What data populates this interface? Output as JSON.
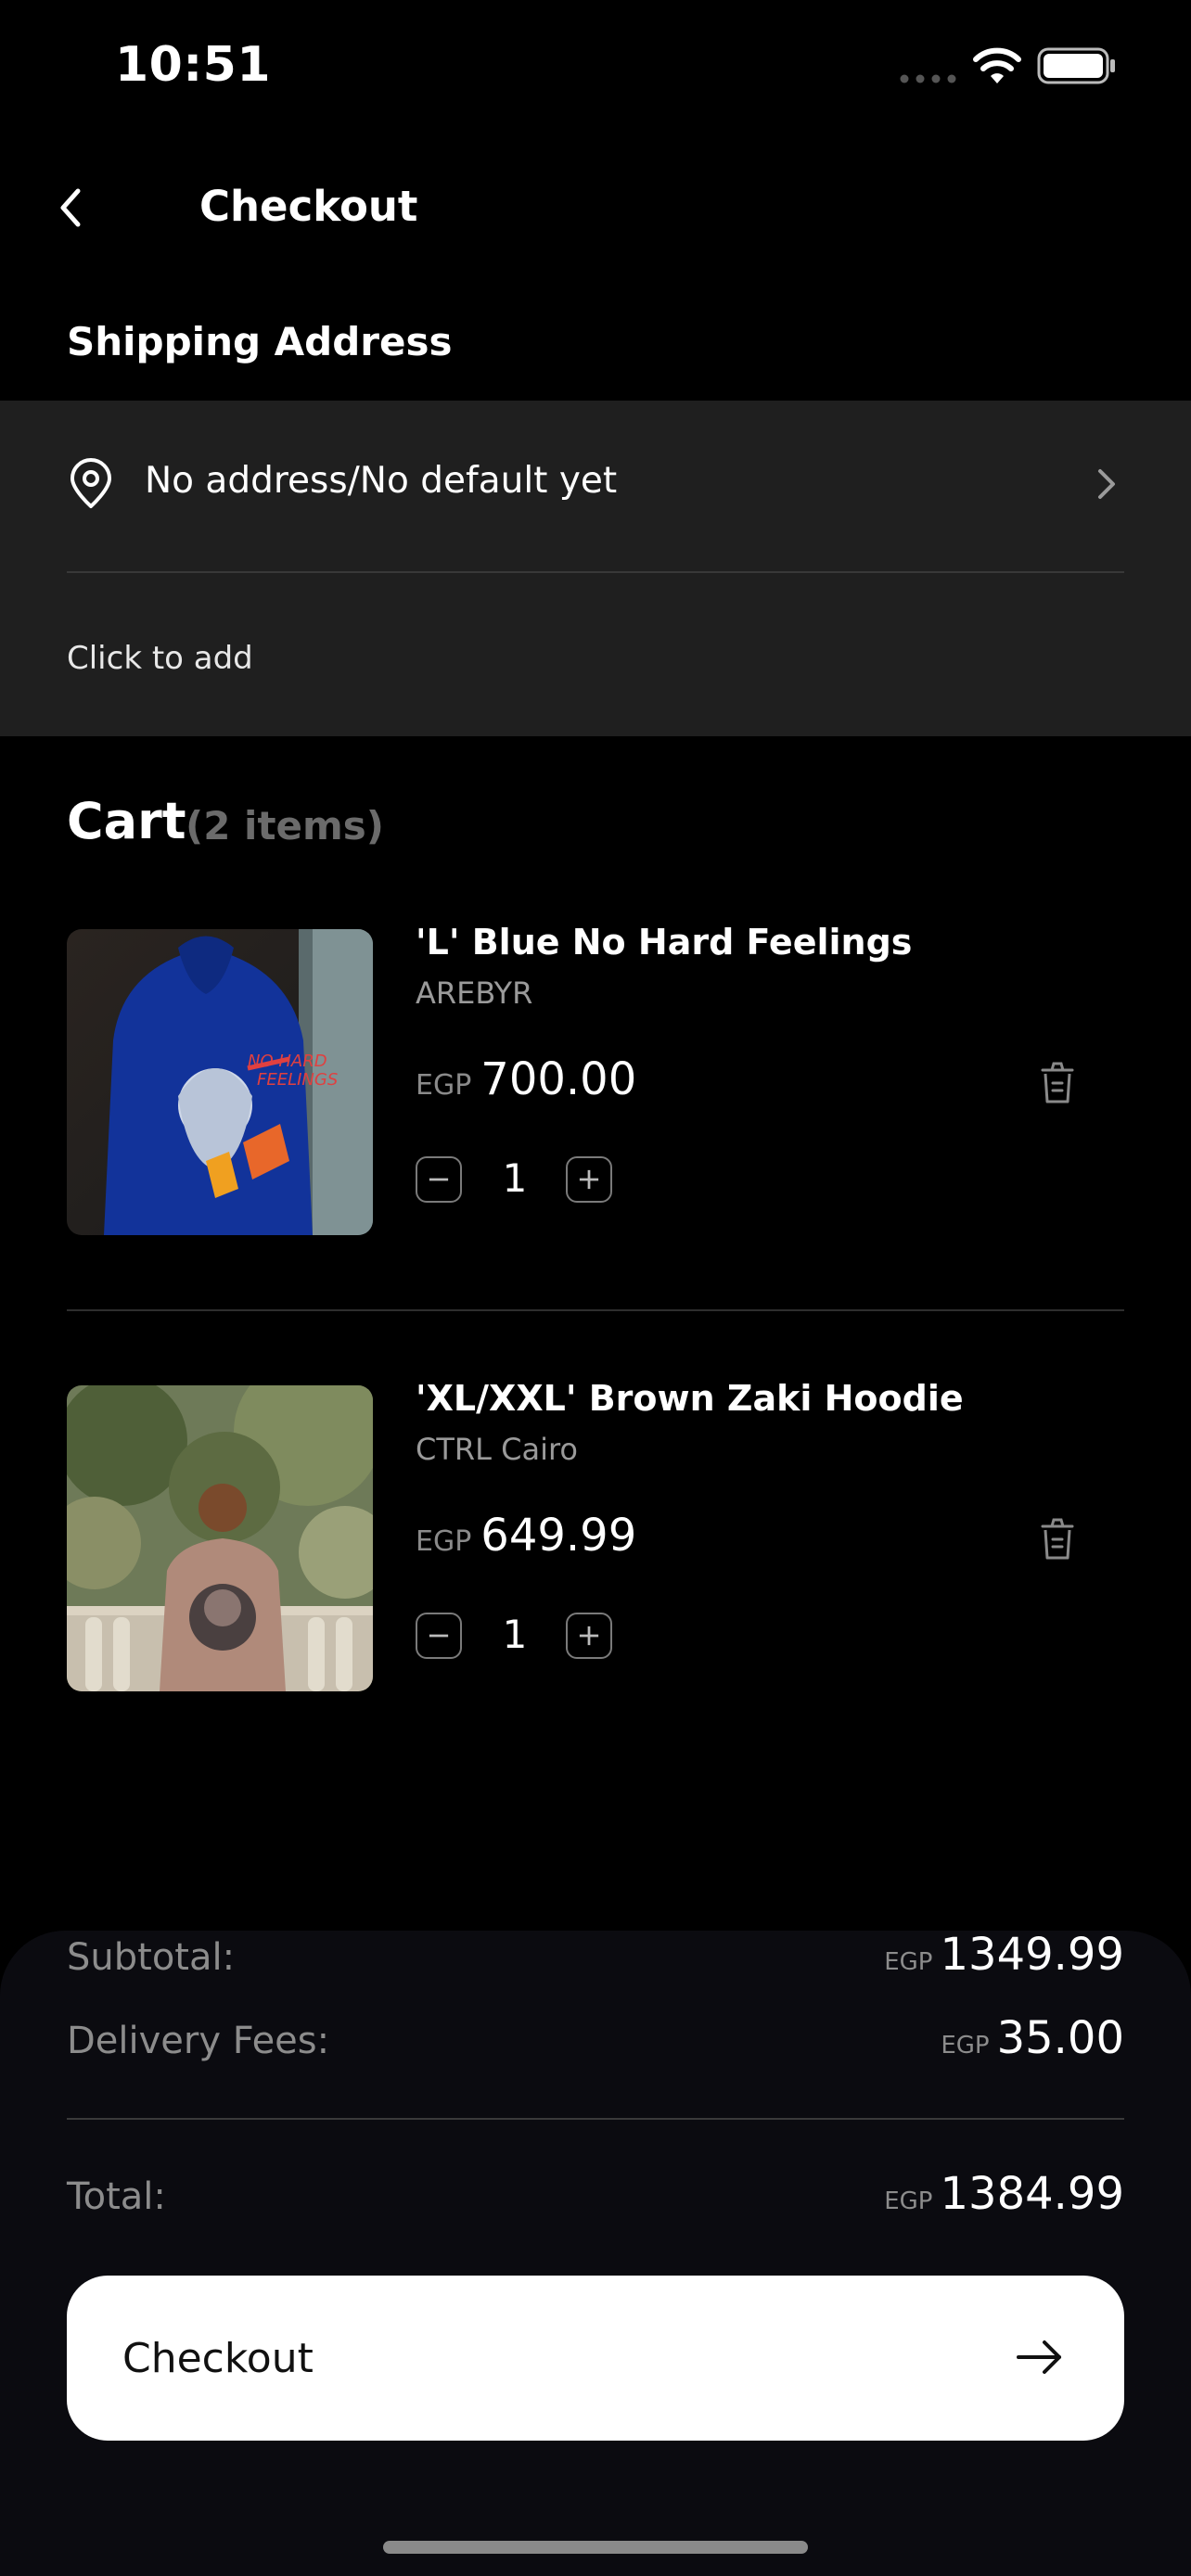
{
  "status_bar": {
    "time": "10:51"
  },
  "header": {
    "title": "Checkout"
  },
  "shipping": {
    "section_title": "Shipping Address",
    "address_text": "No address/No default yet",
    "hint": "Click to add"
  },
  "cart": {
    "title": "Cart",
    "count_label": "(2 items)",
    "items": [
      {
        "name": "'L' Blue No Hard Feelings",
        "brand": "AREBYR",
        "currency": "EGP",
        "price": "700.00",
        "quantity": "1",
        "image_icon": "blue-hoodie-photo"
      },
      {
        "name": "'XL/XXL' Brown Zaki Hoodie",
        "brand": "CTRL Cairo",
        "currency": "EGP",
        "price": "649.99",
        "quantity": "1",
        "image_icon": "brown-hoodie-photo"
      }
    ]
  },
  "summary": {
    "subtotal_label": "Subtotal:",
    "subtotal_currency": "EGP",
    "subtotal_value": "1349.99",
    "delivery_label": "Delivery Fees:",
    "delivery_currency": "EGP",
    "delivery_value": "35.00",
    "total_label": "Total:",
    "total_currency": "EGP",
    "total_value": "1384.99"
  },
  "checkout_button": {
    "label": "Checkout"
  },
  "colors": {
    "background": "#000000",
    "card": "#1f1f1f",
    "summary_panel": "#0b0b10",
    "button": "#ffffff",
    "muted_text": "#8c8c8c"
  }
}
